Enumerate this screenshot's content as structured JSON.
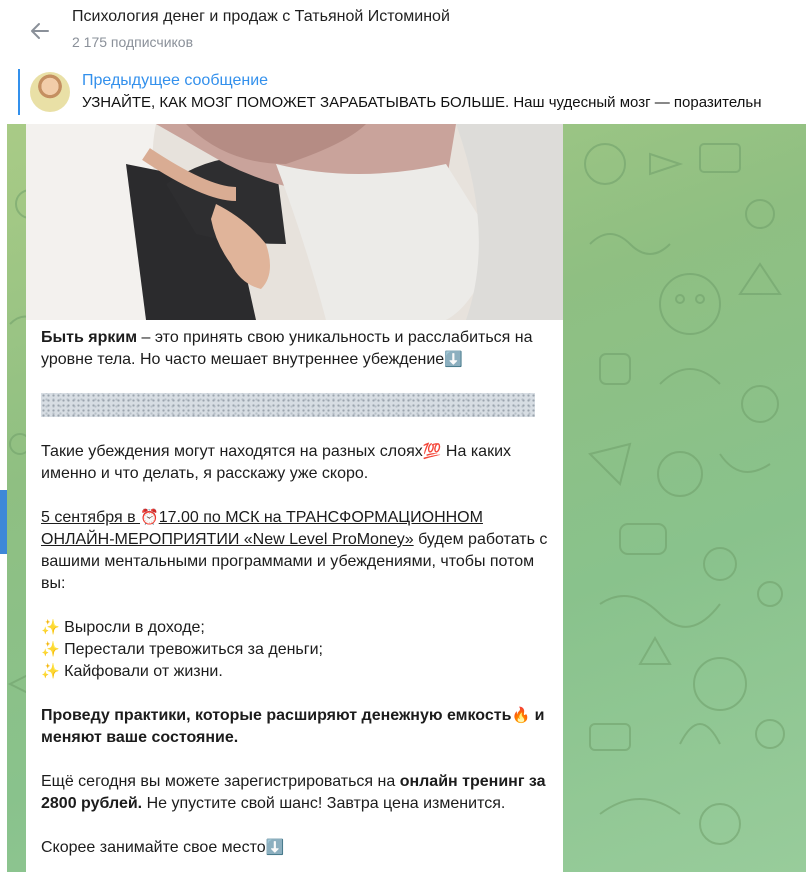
{
  "header": {
    "channel_title": "Психология денег и продаж с Татьяной Истоминой",
    "subscribers": "2 175 подписчиков"
  },
  "pinned": {
    "label": "Предыдущее сообщение",
    "text": "УЗНАЙТЕ, КАК МОЗГ ПОМОЖЕТ ЗАРАБАТЫВАТЬ БОЛЬШЕ.  Наш чудесный мозг — поразительн"
  },
  "message": {
    "p1_bold": "Быть ярким",
    "p1_rest": " – это принять свою уникальность и расслабиться на уровне тела. Но часто мешает внутреннее убеждение",
    "p1_emoji": "⬇️",
    "p2": "Такие убеждения могут находятся на разных слоях",
    "p2_emoji": "💯",
    "p2_rest": " На каких именно и что делать, я расскажу уже скоро.",
    "p3_link1": "5 сентября в ",
    "p3_emoji": "⏰",
    "p3_link2": "17.00 по МСК на ТРАНСФОРМАЦИОННОМ ОНЛАЙН-МЕРОПРИЯТИИ «New Level ProMoney»",
    "p3_rest": " будем работать с вашими ментальными программами и убеждениями, чтобы потом вы:",
    "list_emoji": "✨",
    "list": [
      "Выросли в доходе;",
      "Перестали тревожиться за деньги;",
      "Кайфовали от жизни."
    ],
    "p4_bold": "Проведу практики, которые расширяют денежную емкость",
    "p4_emoji": "🔥",
    "p4_bold2": " и меняют ваше состояние.",
    "p5_start": "Ещё сегодня вы можете зарегистрироваться на ",
    "p5_bold": "онлайн тренинг за 2800 рублей.",
    "p5_rest": " Не упустите свой шанс! Завтра цена изменится.",
    "p6": "Скорее занимайте свое место",
    "p6_emoji": "⬇️"
  },
  "colors": {
    "accent": "#3390ec",
    "wallpaper": "#8fbf82",
    "bubble": "#ffffff"
  }
}
